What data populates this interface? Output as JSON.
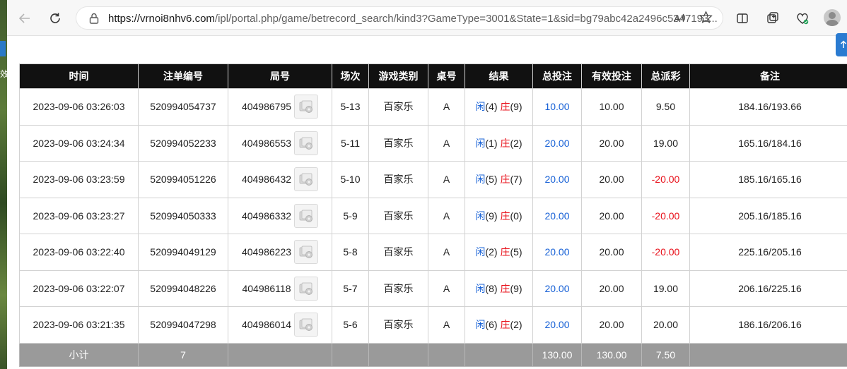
{
  "browser": {
    "url_host": "https://vrnoi8nhv6.com",
    "url_path": "/ipl/portal.php/game/betrecord_search/kind3?GameType=3001&State=1&sid=bg79abc42a2496c5347193...",
    "read_aloud": "Ă",
    "favorite_icon": "star-icon"
  },
  "desktop": {
    "edge_glyph": "效"
  },
  "table": {
    "headers": [
      "时间",
      "注单编号",
      "局号",
      "场次",
      "游戏类别",
      "桌号",
      "结果",
      "总投注",
      "有效投注",
      "总派彩",
      "备注"
    ],
    "rows": [
      {
        "time": "2023-09-06 03:26:03",
        "order": "520994054737",
        "round": "404986795",
        "session": "5-13",
        "game": "百家乐",
        "table": "A",
        "xian_label": "闲",
        "xian": "(4)",
        "zhuang_label": "庄",
        "zhuang": "(9)",
        "bet": "10.00",
        "valid": "10.00",
        "payout": "9.50",
        "payout_color": "#222222",
        "note": "184.16/193.66"
      },
      {
        "time": "2023-09-06 03:24:34",
        "order": "520994052233",
        "round": "404986553",
        "session": "5-11",
        "game": "百家乐",
        "table": "A",
        "xian_label": "闲",
        "xian": "(1)",
        "zhuang_label": "庄",
        "zhuang": "(2)",
        "bet": "20.00",
        "valid": "20.00",
        "payout": "19.00",
        "payout_color": "#222222",
        "note": "165.16/184.16"
      },
      {
        "time": "2023-09-06 03:23:59",
        "order": "520994051226",
        "round": "404986432",
        "session": "5-10",
        "game": "百家乐",
        "table": "A",
        "xian_label": "闲",
        "xian": "(5)",
        "zhuang_label": "庄",
        "zhuang": "(7)",
        "bet": "20.00",
        "valid": "20.00",
        "payout": "-20.00",
        "payout_color": "#e8101a",
        "note": "185.16/165.16"
      },
      {
        "time": "2023-09-06 03:23:27",
        "order": "520994050333",
        "round": "404986332",
        "session": "5-9",
        "game": "百家乐",
        "table": "A",
        "xian_label": "闲",
        "xian": "(9)",
        "zhuang_label": "庄",
        "zhuang": "(0)",
        "bet": "20.00",
        "valid": "20.00",
        "payout": "-20.00",
        "payout_color": "#e8101a",
        "note": "205.16/185.16"
      },
      {
        "time": "2023-09-06 03:22:40",
        "order": "520994049129",
        "round": "404986223",
        "session": "5-8",
        "game": "百家乐",
        "table": "A",
        "xian_label": "闲",
        "xian": "(2)",
        "zhuang_label": "庄",
        "zhuang": "(5)",
        "bet": "20.00",
        "valid": "20.00",
        "payout": "-20.00",
        "payout_color": "#e8101a",
        "note": "225.16/205.16"
      },
      {
        "time": "2023-09-06 03:22:07",
        "order": "520994048226",
        "round": "404986118",
        "session": "5-7",
        "game": "百家乐",
        "table": "A",
        "xian_label": "闲",
        "xian": "(8)",
        "zhuang_label": "庄",
        "zhuang": "(9)",
        "bet": "20.00",
        "valid": "20.00",
        "payout": "19.00",
        "payout_color": "#222222",
        "note": "206.16/225.16"
      },
      {
        "time": "2023-09-06 03:21:35",
        "order": "520994047298",
        "round": "404986014",
        "session": "5-6",
        "game": "百家乐",
        "table": "A",
        "xian_label": "闲",
        "xian": "(6)",
        "zhuang_label": "庄",
        "zhuang": "(2)",
        "bet": "20.00",
        "valid": "20.00",
        "payout": "20.00",
        "payout_color": "#222222",
        "note": "186.16/206.16"
      }
    ],
    "subtotal": {
      "label": "小计",
      "count": "7",
      "bet": "130.00",
      "valid": "130.00",
      "payout": "7.50"
    }
  },
  "colors": {
    "header_bg": "#111111",
    "bet_blue": "#1660d6",
    "loss_red": "#e8101a",
    "subtotal_bg": "#9a9a9a"
  }
}
